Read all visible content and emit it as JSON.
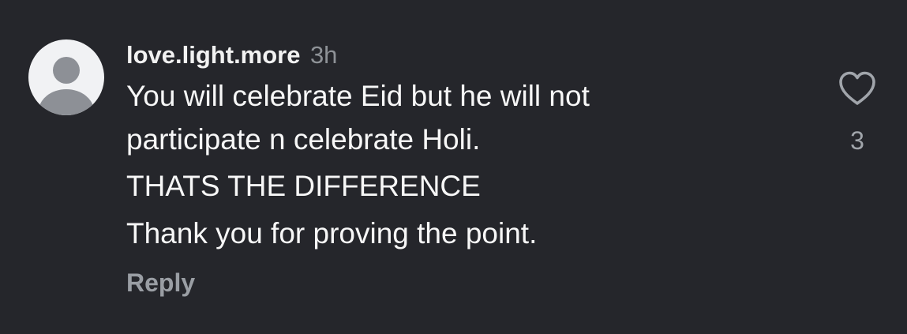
{
  "comment": {
    "avatar_icon": "default-profile-icon",
    "username": "love.light.more",
    "time": "3h",
    "paragraphs": [
      "You will celebrate Eid but he will not participate n celebrate Holi.",
      "THATS THE DIFFERENCE",
      "Thank you for proving the point."
    ],
    "reply_label": "Reply",
    "like_icon": "heart-outline-icon",
    "like_count": "3"
  },
  "colors": {
    "background": "#25262b",
    "text": "#f7f7f7",
    "muted": "#8e9297",
    "avatar_bg": "#f1f2f4",
    "avatar_figure": "#8d9096"
  }
}
